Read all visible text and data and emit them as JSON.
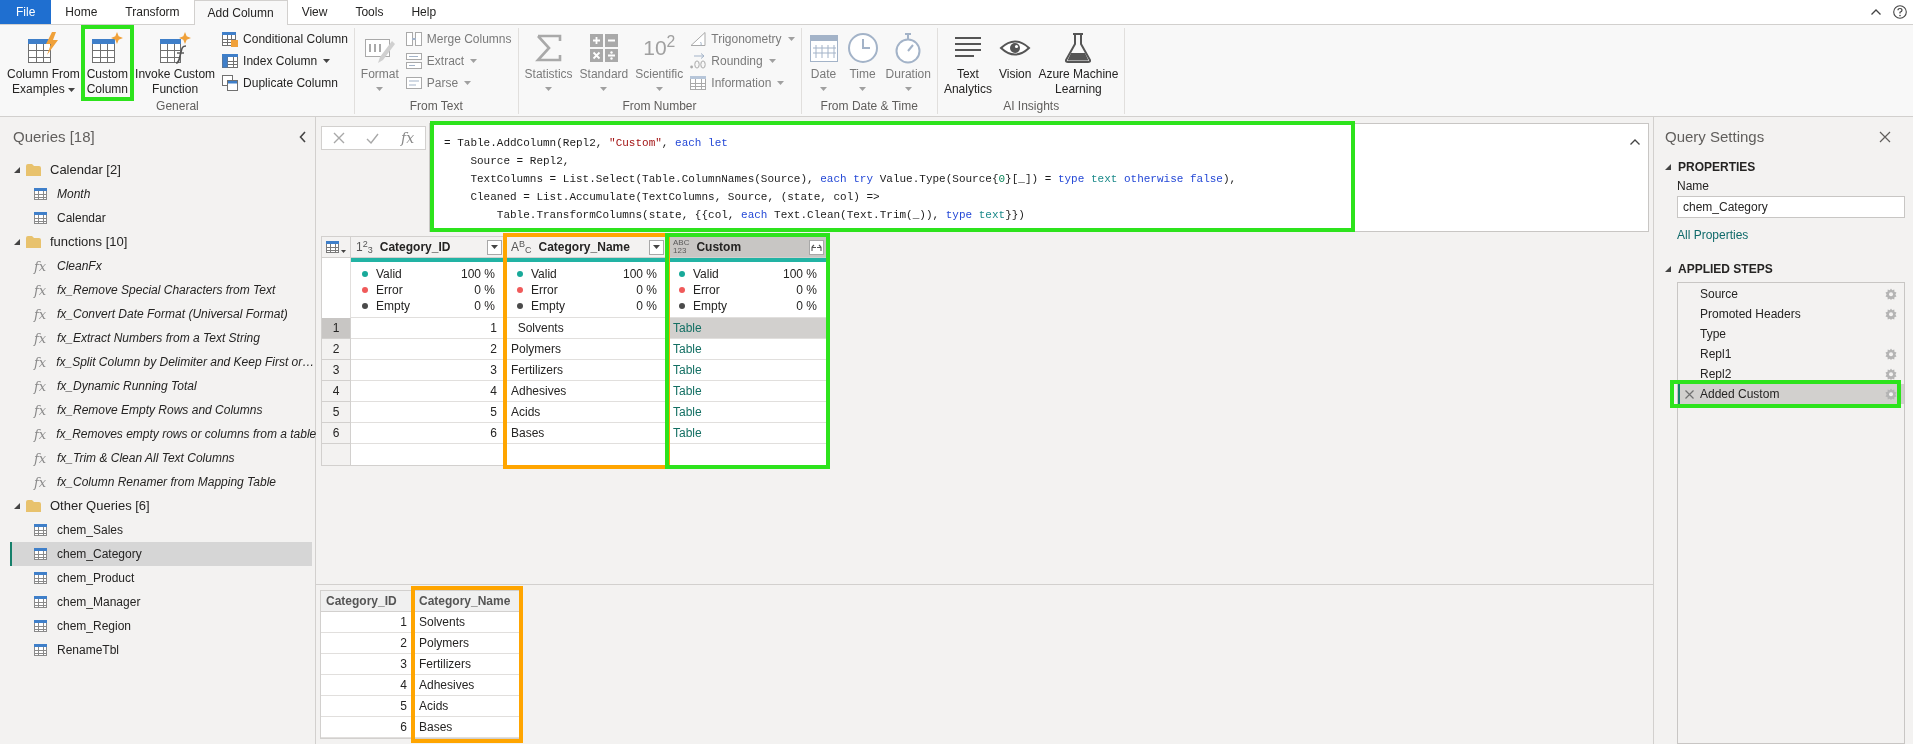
{
  "tabs": [
    {
      "label": "File",
      "kind": "file",
      "selected": false
    },
    {
      "label": "Home",
      "kind": "tab",
      "selected": false
    },
    {
      "label": "Transform",
      "kind": "tab",
      "selected": false
    },
    {
      "label": "Add Column",
      "kind": "tab",
      "selected": true
    },
    {
      "label": "View",
      "kind": "tab",
      "selected": false
    },
    {
      "label": "Tools",
      "kind": "tab",
      "selected": false
    },
    {
      "label": "Help",
      "kind": "tab",
      "selected": false
    }
  ],
  "ribbon": {
    "groups": [
      {
        "label": "General",
        "items": [
          {
            "kind": "large",
            "label_lines": [
              "Column From",
              "Examples"
            ],
            "dropdown": true,
            "disabled": false
          },
          {
            "kind": "large",
            "label_lines": [
              "Custom",
              "Column"
            ],
            "dropdown": false,
            "disabled": false,
            "highlight": {
              "color": "#2de31c"
            }
          },
          {
            "kind": "large",
            "label_lines": [
              "Invoke Custom",
              "Function"
            ],
            "dropdown": false,
            "disabled": false
          },
          {
            "kind": "small",
            "label_lines": [
              "Conditional Column"
            ],
            "dropdown": false,
            "disabled": false
          },
          {
            "kind": "small",
            "label_lines": [
              "Index Column"
            ],
            "dropdown": true,
            "disabled": false
          },
          {
            "kind": "small",
            "label_lines": [
              "Duplicate Column"
            ],
            "dropdown": false,
            "disabled": false
          }
        ]
      },
      {
        "label": "From Text",
        "items": [
          {
            "kind": "large",
            "label_lines": [
              "Format"
            ],
            "dropdown": true,
            "disabled": true
          },
          {
            "kind": "small",
            "label_lines": [
              "Merge Columns"
            ],
            "dropdown": false,
            "disabled": true
          },
          {
            "kind": "small",
            "label_lines": [
              "Extract"
            ],
            "dropdown": true,
            "disabled": true
          },
          {
            "kind": "small",
            "label_lines": [
              "Parse"
            ],
            "dropdown": true,
            "disabled": true
          }
        ]
      },
      {
        "label": "From Number",
        "items": [
          {
            "kind": "large",
            "label_lines": [
              "Statistics"
            ],
            "dropdown": true,
            "disabled": true
          },
          {
            "kind": "large",
            "label_lines": [
              "Standard"
            ],
            "dropdown": true,
            "disabled": true
          },
          {
            "kind": "large",
            "label_lines": [
              "Scientific"
            ],
            "dropdown": true,
            "disabled": true,
            "icon_text": "10$^{2}$"
          },
          {
            "kind": "small",
            "label_lines": [
              "Trigonometry"
            ],
            "dropdown": true,
            "disabled": true
          },
          {
            "kind": "small",
            "label_lines": [
              "Rounding"
            ],
            "dropdown": true,
            "disabled": true
          },
          {
            "kind": "small",
            "label_lines": [
              "Information"
            ],
            "dropdown": true,
            "disabled": true
          }
        ]
      },
      {
        "label": "From Date & Time",
        "items": [
          {
            "kind": "large",
            "label_lines": [
              "Date"
            ],
            "dropdown": true,
            "disabled": true
          },
          {
            "kind": "large",
            "label_lines": [
              "Time"
            ],
            "dropdown": true,
            "disabled": true
          },
          {
            "kind": "large",
            "label_lines": [
              "Duration"
            ],
            "dropdown": true,
            "disabled": true
          }
        ]
      },
      {
        "label": "AI Insights",
        "items": [
          {
            "kind": "large",
            "label_lines": [
              "Text",
              "Analytics"
            ],
            "dropdown": false,
            "disabled": false
          },
          {
            "kind": "large",
            "label_lines": [
              "Vision"
            ],
            "dropdown": false,
            "disabled": false
          },
          {
            "kind": "large",
            "label_lines": [
              "Azure Machine",
              "Learning"
            ],
            "dropdown": false,
            "disabled": false
          }
        ]
      }
    ]
  },
  "queries": {
    "title": "Queries [18]",
    "groups": [
      {
        "label": "Calendar [2]",
        "expanded": true,
        "children": [
          {
            "name": "Month",
            "kind": "table",
            "load_enabled": false,
            "selected": false
          },
          {
            "name": "Calendar",
            "kind": "table",
            "load_enabled": true,
            "selected": false
          }
        ]
      },
      {
        "label": "functions [10]",
        "expanded": true,
        "children": [
          {
            "name": "CleanFx",
            "kind": "function",
            "glyph": "fx",
            "load_enabled": false,
            "selected": false
          },
          {
            "name": "fx_Remove Special Characters from Text",
            "kind": "function",
            "glyph": "fx",
            "load_enabled": false,
            "selected": false
          },
          {
            "name": "fx_Convert Date Format (Universal Format)",
            "kind": "function",
            "glyph": "fx",
            "load_enabled": false,
            "selected": false
          },
          {
            "name": "fx_Extract Numbers from a Text String",
            "kind": "function",
            "glyph": "fx",
            "load_enabled": false,
            "selected": false
          },
          {
            "name": "fx_Split Column by Delimiter and Keep First or…",
            "kind": "function",
            "glyph": "fx",
            "load_enabled": false,
            "selected": false
          },
          {
            "name": "fx_Dynamic Running Total",
            "kind": "function",
            "glyph": "fx",
            "load_enabled": false,
            "selected": false
          },
          {
            "name": "fx_Remove Empty Rows and Columns",
            "kind": "function",
            "glyph": "fx",
            "load_enabled": false,
            "selected": false
          },
          {
            "name": "fx_Removes empty rows or columns from a table",
            "kind": "function",
            "glyph": "fx",
            "load_enabled": false,
            "selected": false
          },
          {
            "name": "fx_Trim & Clean All Text Columns",
            "kind": "function",
            "glyph": "fx",
            "load_enabled": false,
            "selected": false
          },
          {
            "name": "fx_Column Renamer from Mapping Table",
            "kind": "function",
            "glyph": "fx",
            "load_enabled": false,
            "selected": false
          }
        ]
      },
      {
        "label": "Other Queries [6]",
        "expanded": true,
        "children": [
          {
            "name": "chem_Sales",
            "kind": "table",
            "load_enabled": true,
            "selected": false
          },
          {
            "name": "chem_Category",
            "kind": "table",
            "load_enabled": true,
            "selected": true
          },
          {
            "name": "chem_Product",
            "kind": "table",
            "load_enabled": true,
            "selected": false
          },
          {
            "name": "chem_Manager",
            "kind": "table",
            "load_enabled": true,
            "selected": false
          },
          {
            "name": "chem_Region",
            "kind": "table",
            "load_enabled": true,
            "selected": false
          },
          {
            "name": "RenameTbl",
            "kind": "table",
            "load_enabled": true,
            "selected": false
          }
        ]
      }
    ]
  },
  "formula_bar": {
    "glyph": "fx",
    "highlight": {
      "color": "#2de31c"
    },
    "lines": [
      [
        {
          "text": "= Table.AddColumn(Repl2, ",
          "kind": "plain"
        },
        {
          "text": "\"Custom\"",
          "kind": "string"
        },
        {
          "text": ", ",
          "kind": "plain"
        },
        {
          "text": "each let",
          "kind": "keyword"
        }
      ],
      [
        {
          "text": "    Source = Repl2,",
          "kind": "plain"
        }
      ],
      [
        {
          "text": "    TextColumns = List.Select(Table.ColumnNames(Source), ",
          "kind": "plain"
        },
        {
          "text": "each try",
          "kind": "keyword"
        },
        {
          "text": " Value.Type(Source{",
          "kind": "plain"
        },
        {
          "text": "0",
          "kind": "number"
        },
        {
          "text": "}[_]) = ",
          "kind": "plain"
        },
        {
          "text": "type",
          "kind": "keyword"
        },
        {
          "text": " text",
          "kind": "type"
        },
        {
          "text": " otherwise false",
          "kind": "keyword"
        },
        {
          "text": "),",
          "kind": "plain"
        }
      ],
      [
        {
          "text": "    Cleaned = List.Accumulate(TextColumns, Source, (state, col) =>",
          "kind": "plain"
        }
      ],
      [
        {
          "text": "        Table.TransformColumns(state, {{col, ",
          "kind": "plain"
        },
        {
          "text": "each",
          "kind": "keyword"
        },
        {
          "text": " Text.Clean(Text.Trim(_)), ",
          "kind": "plain"
        },
        {
          "text": "type",
          "kind": "keyword"
        },
        {
          "text": " text",
          "kind": "type"
        },
        {
          "text": "}})",
          "kind": "plain"
        }
      ]
    ]
  },
  "grid": {
    "columns": [
      {
        "name": "Category_ID",
        "kind": "number",
        "type_label": [
          "1$^{2}$$_{3}$"
        ],
        "selected": false,
        "valid_bar": {
          "level": 1
        },
        "quality": [
          {
            "label": "Valid",
            "value": "100 %",
            "color": "#18a999"
          },
          {
            "label": "Error",
            "value": "0 %",
            "color": "#f05a5a"
          },
          {
            "label": "Empty",
            "value": "0 %",
            "color": "#4a4a4a"
          }
        ]
      },
      {
        "name": "Category_Name",
        "kind": "text",
        "type_label": [
          "A$^{B}$$_{C}$"
        ],
        "selected": false,
        "highlight": {
          "color": "#ffa500"
        },
        "valid_bar": {
          "level": 1
        },
        "quality": [
          {
            "label": "Valid",
            "value": "100 %",
            "color": "#18a999"
          },
          {
            "label": "Error",
            "value": "0 %",
            "color": "#f05a5a"
          },
          {
            "label": "Empty",
            "value": "0 %",
            "color": "#4a4a4a"
          }
        ]
      },
      {
        "name": "Custom",
        "kind": "table",
        "type_label": [
          "ABC",
          "123"
        ],
        "selected": true,
        "highlight": {
          "color": "#2de31c"
        },
        "valid_bar": {
          "level": 1
        },
        "quality": [
          {
            "label": "Valid",
            "value": "100 %",
            "color": "#18a999"
          },
          {
            "label": "Error",
            "value": "0 %",
            "color": "#f05a5a"
          },
          {
            "label": "Empty",
            "value": "0 %",
            "color": "#4a4a4a"
          }
        ]
      }
    ],
    "rows": [
      {
        "number": "1",
        "selected": true,
        "cells": [
          "1",
          "  Solvents",
          "Table"
        ]
      },
      {
        "number": "2",
        "selected": false,
        "cells": [
          "2",
          "Polymers",
          "Table"
        ]
      },
      {
        "number": "3",
        "selected": false,
        "cells": [
          "3",
          "Fertilizers",
          "Table"
        ]
      },
      {
        "number": "4",
        "selected": false,
        "cells": [
          "4",
          "Adhesives",
          "Table"
        ]
      },
      {
        "number": "5",
        "selected": false,
        "cells": [
          "5",
          "Acids",
          "Table"
        ]
      },
      {
        "number": "6",
        "selected": false,
        "cells": [
          "6",
          "Bases",
          "Table"
        ]
      }
    ]
  },
  "preview": {
    "columns": [
      {
        "name": "Category_ID",
        "kind": "number"
      },
      {
        "name": "Category_Name",
        "kind": "text",
        "highlight": {
          "color": "#ffa500"
        }
      }
    ],
    "rows": [
      [
        "1",
        "Solvents"
      ],
      [
        "2",
        "Polymers"
      ],
      [
        "3",
        "Fertilizers"
      ],
      [
        "4",
        "Adhesives"
      ],
      [
        "5",
        "Acids"
      ],
      [
        "6",
        "Bases"
      ]
    ]
  },
  "query_settings": {
    "title": "Query Settings",
    "properties": {
      "heading": "PROPERTIES",
      "expanded": true,
      "name_label": "Name",
      "name_value": "chem_Category",
      "link": "All Properties"
    },
    "applied_steps": {
      "heading": "APPLIED STEPS",
      "expanded": true,
      "steps": [
        {
          "name": "Source",
          "has_settings": true,
          "selected": false
        },
        {
          "name": "Promoted Headers",
          "has_settings": true,
          "selected": false
        },
        {
          "name": "Type",
          "has_settings": false,
          "selected": false
        },
        {
          "name": "Repl1",
          "has_settings": true,
          "selected": false
        },
        {
          "name": "Repl2",
          "has_settings": true,
          "selected": false
        },
        {
          "name": "Added Custom",
          "has_settings": true,
          "selected": true,
          "highlight": {
            "color": "#2de31c"
          }
        }
      ]
    }
  }
}
